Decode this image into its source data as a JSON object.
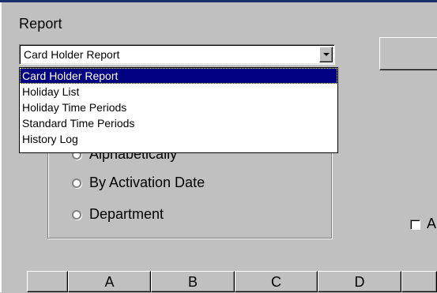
{
  "report": {
    "label": "Report",
    "selected_value": "Card Holder Report",
    "options": [
      "Card Holder Report",
      "Holiday List",
      "Holiday Time Periods",
      "Standard Time Periods",
      "History Log"
    ],
    "selected_index": 0
  },
  "sort": {
    "options": [
      "Alphabetically",
      "By Activation Date",
      "Department"
    ]
  },
  "checkbox": {
    "label": "A"
  },
  "grid": {
    "columns": [
      "",
      "A",
      "B",
      "C",
      "D",
      ""
    ]
  },
  "colors": {
    "window_bg": "#c0c0c0",
    "selection_bg": "#000080",
    "title_bar": "#1c2f6c"
  }
}
